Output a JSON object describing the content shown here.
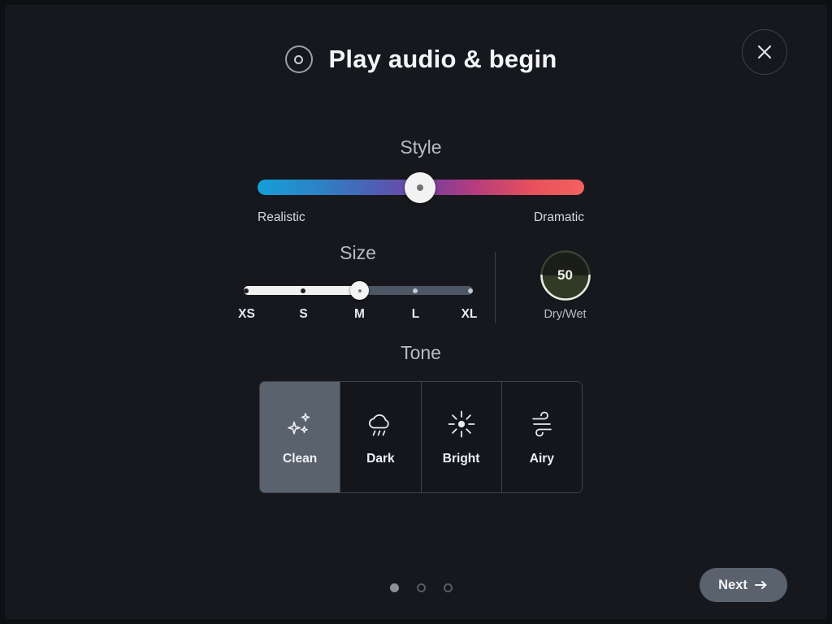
{
  "header": {
    "title": "Play audio & begin",
    "record_icon": "record-disc-icon",
    "close_icon": "close-icon"
  },
  "style": {
    "label": "Style",
    "min_label": "Realistic",
    "max_label": "Dramatic",
    "value_percent": 50,
    "gradient_start": "#159fd8",
    "gradient_mid": "#7a3f9e",
    "gradient_end": "#f4625f"
  },
  "size": {
    "label": "Size",
    "selected": "M",
    "ticks": [
      {
        "label": "XS",
        "percent": 0
      },
      {
        "label": "S",
        "percent": 25
      },
      {
        "label": "M",
        "percent": 50
      },
      {
        "label": "L",
        "percent": 75
      },
      {
        "label": "XL",
        "percent": 100
      }
    ]
  },
  "drywet": {
    "label": "Dry/Wet",
    "value": "50"
  },
  "tone": {
    "label": "Tone",
    "selected": "Clean",
    "options": [
      {
        "label": "Clean",
        "icon": "sparkles-icon",
        "selected": true
      },
      {
        "label": "Dark",
        "icon": "rain-cloud-icon",
        "selected": false
      },
      {
        "label": "Bright",
        "icon": "sun-icon",
        "selected": false
      },
      {
        "label": "Airy",
        "icon": "wind-icon",
        "selected": false
      }
    ]
  },
  "footer": {
    "pagination": {
      "total": 3,
      "active_index": 0
    },
    "next_label": "Next",
    "next_icon": "arrow-right-icon"
  },
  "colors": {
    "background": "#17181d",
    "accent_selected": "#5a626e",
    "text_primary": "#f2f4f7",
    "text_secondary": "#b6bcc6"
  }
}
